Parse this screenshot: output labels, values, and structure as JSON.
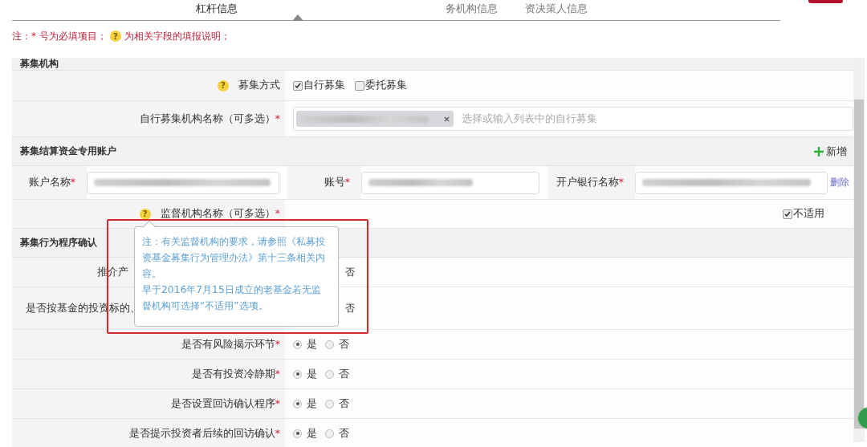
{
  "tabs": [
    {
      "label": "杠杆信息",
      "selected": true
    },
    {
      "label": "务机构信息",
      "selected": false
    },
    {
      "label": "资决策人信息",
      "selected": false
    }
  ],
  "note": {
    "text": "注：* 号为必填项目；",
    "icon": "?",
    "hint": "为相关字段的填报说明；"
  },
  "sections": [
    {
      "title": "募集机构",
      "rows": [
        {
          "kind": "checkboxes",
          "help": "?",
          "label": "募集方式",
          "options": [
            {
              "label": "自行募集",
              "checked": true
            },
            {
              "label": "委托募集",
              "checked": false
            }
          ]
        },
        {
          "kind": "multiselect",
          "label": "自行募集机构名称（可多选）",
          "required": "*",
          "placeholder": "选择或输入列表中的自行募集"
        }
      ]
    },
    {
      "title": "募集结算资金专用账户",
      "action": "新增",
      "rows": [
        {
          "kind": "account",
          "fields": [
            {
              "label": "账户名称",
              "required": "*"
            },
            {
              "label": "账号",
              "required": "*"
            },
            {
              "label": "开户银行名称",
              "required": "*"
            }
          ],
          "delete": "删除"
        },
        {
          "kind": "supervisor",
          "help": "?",
          "label": "监督机构名称（可多选）",
          "required": "*",
          "na": {
            "label": "不适用",
            "checked": true
          }
        }
      ]
    },
    {
      "title": "募集行为程序确认",
      "rows": [
        {
          "kind": "obscured",
          "label": "推介产",
          "option": "否"
        },
        {
          "kind": "obscured",
          "label": "是否按基金的投资标的、",
          "option": "否"
        },
        {
          "kind": "radio",
          "label": "是否有风险揭示环节",
          "required": "*",
          "options": [
            {
              "label": "是",
              "selected": true
            },
            {
              "label": "否",
              "selected": false
            }
          ]
        },
        {
          "kind": "radio",
          "label": "是否有投资冷静期",
          "required": "*",
          "options": [
            {
              "label": "是",
              "selected": true
            },
            {
              "label": "否",
              "selected": false
            }
          ]
        },
        {
          "kind": "radio",
          "label": "是否设置回访确认程序",
          "required": "*",
          "options": [
            {
              "label": "是",
              "selected": true
            },
            {
              "label": "否",
              "selected": false
            }
          ]
        },
        {
          "kind": "radio",
          "label": "是否提示投资者后续的回访确认",
          "required": "*",
          "options": [
            {
              "label": "是",
              "selected": true
            },
            {
              "label": "否",
              "selected": false
            }
          ]
        }
      ]
    }
  ],
  "tooltip": {
    "lines": [
      "注：有关监督机构的要求，请参照《私募投资基金募集行为管理办法》第十三条相关内容。",
      "早于2016年7月15日成立的老基金若无监督机构可选择“不适用”选项。"
    ]
  }
}
